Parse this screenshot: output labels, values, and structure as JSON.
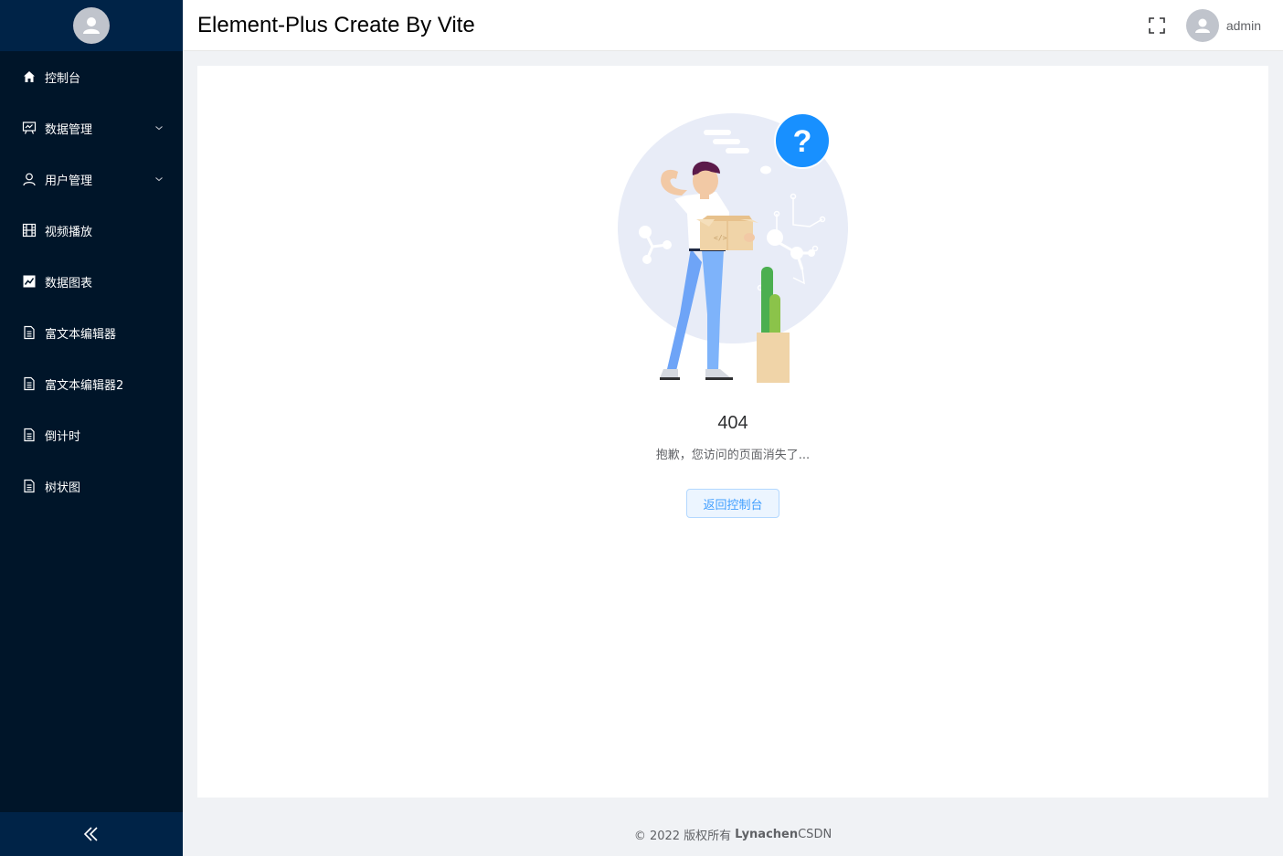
{
  "header": {
    "title": "Element-Plus Create By Vite",
    "username": "admin"
  },
  "sidebar": {
    "items": [
      {
        "label": "控制台",
        "icon": "home-icon",
        "has_arrow": false
      },
      {
        "label": "数据管理",
        "icon": "presentation-icon",
        "has_arrow": true
      },
      {
        "label": "用户管理",
        "icon": "user-icon",
        "has_arrow": true
      },
      {
        "label": "视频播放",
        "icon": "film-icon",
        "has_arrow": false
      },
      {
        "label": "数据图表",
        "icon": "chart-icon",
        "has_arrow": false
      },
      {
        "label": "富文本编辑器",
        "icon": "document-icon",
        "has_arrow": false
      },
      {
        "label": "富文本编辑器2",
        "icon": "document-icon",
        "has_arrow": false
      },
      {
        "label": "倒计时",
        "icon": "document-icon",
        "has_arrow": false
      },
      {
        "label": "树状图",
        "icon": "document-icon",
        "has_arrow": false
      }
    ]
  },
  "error": {
    "code": "404",
    "message": "抱歉，您访问的页面消失了...",
    "back_button": "返回控制台",
    "question_mark": "?"
  },
  "footer": {
    "copyright": "© 2022 版权所有",
    "author": "Lynachen",
    "link": "CSDN"
  },
  "colors": {
    "sidebar_bg": "#001529",
    "sidebar_top": "#002347",
    "accent": "#409eff",
    "question_circle": "#1890ff"
  }
}
